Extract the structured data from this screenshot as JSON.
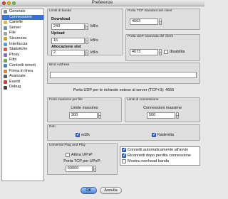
{
  "window": {
    "title": "Preferenze"
  },
  "sidebar": {
    "items": [
      {
        "label": "Generale",
        "icon": "gear-icon",
        "color": "#7d8a96"
      },
      {
        "label": "Connessione",
        "icon": "network-icon",
        "color": "#3a7bd5",
        "selected": true
      },
      {
        "label": "Cartelle",
        "icon": "folder-icon",
        "color": "#e0b94f"
      },
      {
        "label": "Server",
        "icon": "server-icon",
        "color": "#6b8fb5"
      },
      {
        "label": "File",
        "icon": "file-icon",
        "color": "#9aa6b2"
      },
      {
        "label": "Sicurezza",
        "icon": "shield-icon",
        "color": "#c9a227"
      },
      {
        "label": "Interfaccia",
        "icon": "window-icon",
        "color": "#5aa0d8"
      },
      {
        "label": "Statistiche",
        "icon": "chart-icon",
        "color": "#d05a5a"
      },
      {
        "label": "Proxy",
        "icon": "proxy-icon",
        "color": "#8a6bbd"
      },
      {
        "label": "Filtri",
        "icon": "filter-icon",
        "color": "#6aa84f"
      },
      {
        "label": "Controlli remoti",
        "icon": "remote-icon",
        "color": "#4f7fb0"
      },
      {
        "label": "Firma in linea",
        "icon": "signature-icon",
        "color": "#d08b3a"
      },
      {
        "label": "Avanzate",
        "icon": "advanced-icon",
        "color": "#5b5b5b"
      },
      {
        "label": "Eventi",
        "icon": "event-icon",
        "color": "#c2443b"
      },
      {
        "label": "Debug",
        "icon": "debug-icon",
        "color": "#444444"
      }
    ]
  },
  "bandwidth": {
    "title": "Limiti di banda",
    "download_label": "Download",
    "download_value": "240",
    "upload_label": "Upload",
    "upload_value": "16",
    "slot_label": "Allocazione slot",
    "slot_value": "2",
    "unit": "kB/s"
  },
  "tcp": {
    "title": "Porta TCP standard del client",
    "value": "4663"
  },
  "udp": {
    "title": "Porta UDP avanzata del client",
    "value": "4673",
    "disable_label": "disabilita"
  },
  "bind": {
    "title": "Bind Address",
    "value": ""
  },
  "udp_info": "Porta UDP per le richieste estese al server (TCP+3): 4666",
  "sources": {
    "title": "Fonti massime per file",
    "label": "Limite massimo",
    "value": "300"
  },
  "connections": {
    "title": "Limiti di connessione",
    "label": "Connessioni massime",
    "value": "500"
  },
  "networks": {
    "title": "Reti",
    "ed2k": "ed2k",
    "kademlia": "Kademlia"
  },
  "upnp": {
    "title": "Universal Plug and Play",
    "enable_label": "Attiva UPnP",
    "port_label": "Porta TCP per UPnP:",
    "port_value": "50000"
  },
  "options": [
    {
      "label": "Connetti automaticamente all'avvio",
      "checked": true
    },
    {
      "label": "Riconnetti dopo perdita connessione",
      "checked": true
    },
    {
      "label": "Mostra overhead banda",
      "checked": false
    }
  ],
  "buttons": {
    "ok": "OK",
    "cancel": "Annulla"
  }
}
